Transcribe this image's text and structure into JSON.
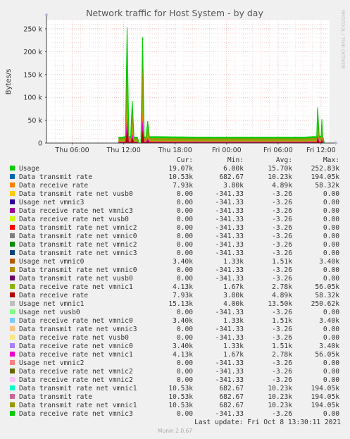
{
  "chart_data": {
    "type": "area",
    "title": "Network traffic for Host System - by day",
    "ylabel": "Bytes/s",
    "side_label": "RRDTOOL / TOBI OETIKER",
    "ylim": [
      0,
      270000
    ],
    "yticks": [
      0,
      50000,
      100000,
      150000,
      200000,
      250000
    ],
    "ytick_labels": [
      "0",
      "50 k",
      "100 k",
      "150 k",
      "200 k",
      "250 k"
    ],
    "xlim": [
      0,
      33
    ],
    "xticks": [
      3,
      9,
      15,
      21,
      27,
      32
    ],
    "xtick_labels": [
      "Thu 06:00",
      "Thu 12:00",
      "Thu 18:00",
      "Fri 00:00",
      "Fri 06:00",
      "Fri 12:00"
    ],
    "grid": true,
    "total": {
      "x": [
        8.4,
        8.6,
        8.8,
        9.0,
        9.2,
        9.4,
        9.6,
        9.8,
        10.0,
        10.2,
        10.4,
        10.6,
        10.8,
        11.0,
        11.2,
        11.4,
        11.6,
        11.8,
        12.0,
        12.2,
        12.4,
        12.6,
        13,
        15,
        18,
        21,
        24,
        27,
        30,
        31.0,
        31.3,
        31.5,
        31.6,
        31.8,
        32.0,
        32.1,
        32.2,
        32.4
      ],
      "values": [
        13000,
        13000,
        13000,
        13000,
        15000,
        253000,
        15000,
        13000,
        92000,
        13000,
        13000,
        13000,
        0,
        0,
        232000,
        14000,
        13000,
        48000,
        14000,
        14000,
        14000,
        14000,
        14000,
        13500,
        13000,
        13000,
        13000,
        13000,
        13000,
        14000,
        14000,
        14000,
        78000,
        15000,
        15000,
        52000,
        15000,
        0
      ]
    },
    "series": [
      {
        "name": "Usage",
        "color": "#00cc00",
        "cur": "19.07k",
        "min": "6.00k",
        "avg": "15.70k",
        "max": "252.83k"
      },
      {
        "name": "Data transmit rate",
        "color": "#0066b3",
        "cur": "10.53k",
        "min": "682.67",
        "avg": "10.23k",
        "max": "194.05k"
      },
      {
        "name": "Data receive rate",
        "color": "#ff8000",
        "cur": "7.93k",
        "min": "3.80k",
        "avg": "4.89k",
        "max": "58.32k"
      },
      {
        "name": "Data transmit rate net vusb0",
        "color": "#ffcc00",
        "cur": "0.00",
        "min": "-341.33",
        "avg": "-3.26",
        "max": "0.00"
      },
      {
        "name": "Usage net vmnic3",
        "color": "#330099",
        "cur": "0.00",
        "min": "-341.33",
        "avg": "-3.26",
        "max": "0.00"
      },
      {
        "name": "Data receive rate net vmnic3",
        "color": "#990099",
        "cur": "0.00",
        "min": "-341.33",
        "avg": "-3.26",
        "max": "0.00"
      },
      {
        "name": "Data receive rate net vusb0",
        "color": "#ccff00",
        "cur": "0.00",
        "min": "-341.33",
        "avg": "-3.26",
        "max": "0.00"
      },
      {
        "name": "Data transmit rate net vmnic2",
        "color": "#ff0000",
        "cur": "0.00",
        "min": "-341.33",
        "avg": "-3.26",
        "max": "0.00"
      },
      {
        "name": "Data transmit rate net vmnic0",
        "color": "#808080",
        "cur": "0.00",
        "min": "-341.33",
        "avg": "-3.26",
        "max": "0.00"
      },
      {
        "name": "Data transmit rate net vmnic2",
        "color": "#008f00",
        "cur": "0.00",
        "min": "-341.33",
        "avg": "-3.26",
        "max": "0.00"
      },
      {
        "name": "Data transmit rate net vmnic3",
        "color": "#00487d",
        "cur": "0.00",
        "min": "-341.33",
        "avg": "-3.26",
        "max": "0.00"
      },
      {
        "name": "Usage net vmnic0",
        "color": "#b35a00",
        "cur": "3.40k",
        "min": "1.33k",
        "avg": "1.51k",
        "max": "3.40k"
      },
      {
        "name": "Data transmit rate net vmnic0",
        "color": "#b38f00",
        "cur": "0.00",
        "min": "-341.33",
        "avg": "-3.26",
        "max": "0.00"
      },
      {
        "name": "Data transmit rate net vusb0",
        "color": "#6b006b",
        "cur": "0.00",
        "min": "-341.33",
        "avg": "-3.26",
        "max": "0.00"
      },
      {
        "name": "Data receive rate net vmnic1",
        "color": "#8fb300",
        "cur": "4.13k",
        "min": "1.67k",
        "avg": "2.78k",
        "max": "56.05k"
      },
      {
        "name": "Data receive rate",
        "color": "#b30000",
        "cur": "7.93k",
        "min": "3.80k",
        "avg": "4.89k",
        "max": "58.32k"
      },
      {
        "name": "Usage net vmnic1",
        "color": "#bebebe",
        "cur": "15.13k",
        "min": "4.00k",
        "avg": "13.50k",
        "max": "250.62k"
      },
      {
        "name": "Usage net vusb0",
        "color": "#80ff80",
        "cur": "0.00",
        "min": "-341.33",
        "avg": "-3.26",
        "max": "0.00"
      },
      {
        "name": "Data receive rate net vmnic0",
        "color": "#80c9ff",
        "cur": "3.40k",
        "min": "1.33k",
        "avg": "1.51k",
        "max": "3.40k"
      },
      {
        "name": "Data transmit rate net vmnic3",
        "color": "#ffc080",
        "cur": "0.00",
        "min": "-341.33",
        "avg": "-3.26",
        "max": "0.00"
      },
      {
        "name": "Data receive rate net vusb0",
        "color": "#ffe680",
        "cur": "0.00",
        "min": "-341.33",
        "avg": "-3.26",
        "max": "0.00"
      },
      {
        "name": "Data receive rate net vmnic0",
        "color": "#aa80ff",
        "cur": "3.40k",
        "min": "1.33k",
        "avg": "1.51k",
        "max": "3.40k"
      },
      {
        "name": "Data receive rate net vmnic1",
        "color": "#ee00cc",
        "cur": "4.13k",
        "min": "1.67k",
        "avg": "2.78k",
        "max": "56.05k"
      },
      {
        "name": "Usage net vmnic2",
        "color": "#ff8080",
        "cur": "0.00",
        "min": "-341.33",
        "avg": "-3.26",
        "max": "0.00"
      },
      {
        "name": "Data receive rate net vmnic2",
        "color": "#666600",
        "cur": "0.00",
        "min": "-341.33",
        "avg": "-3.26",
        "max": "0.00"
      },
      {
        "name": "Data receive rate net vmnic2",
        "color": "#ffbfff",
        "cur": "0.00",
        "min": "-341.33",
        "avg": "-3.26",
        "max": "0.00"
      },
      {
        "name": "Data transmit rate net vmnic1",
        "color": "#00ffcc",
        "cur": "10.53k",
        "min": "682.67",
        "avg": "10.23k",
        "max": "194.05k"
      },
      {
        "name": "Data transmit rate",
        "color": "#cc6699",
        "cur": "10.53k",
        "min": "682.67",
        "avg": "10.23k",
        "max": "194.05k"
      },
      {
        "name": "Data transmit rate net vmnic1",
        "color": "#999900",
        "cur": "10.53k",
        "min": "682.67",
        "avg": "10.23k",
        "max": "194.05k"
      },
      {
        "name": "Data receive rate net vmnic3",
        "color": "#00cc00",
        "cur": "0.00",
        "min": "-341.33",
        "avg": "-3.26",
        "max": "0.00"
      }
    ],
    "columns": [
      "Cur:",
      "Min:",
      "Avg:",
      "Max:"
    ]
  },
  "footer": {
    "last_update": "Last update: Fri Oct  8 13:30:11 2021",
    "version": "Munin 2.0.67"
  }
}
